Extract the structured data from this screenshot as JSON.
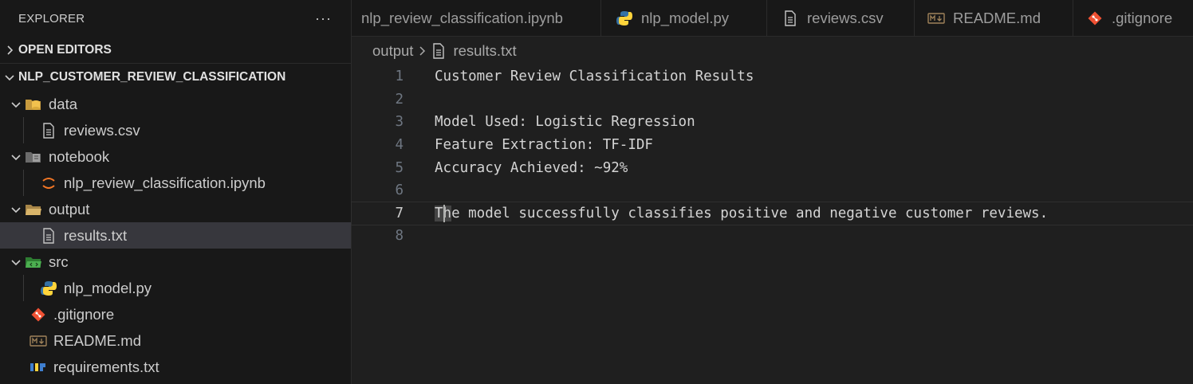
{
  "explorer": {
    "title": "EXPLORER",
    "more_actions": "···",
    "open_editors_label": "OPEN EDITORS",
    "project_label": "NLP_CUSTOMER_REVIEW_CLASSIFICATION",
    "tree": [
      {
        "label": "data",
        "kind": "folder",
        "icon": "folder-data-icon"
      },
      {
        "label": "reviews.csv",
        "kind": "file",
        "icon": "text-file-icon"
      },
      {
        "label": "notebook",
        "kind": "folder",
        "icon": "folder-notebook-icon"
      },
      {
        "label": "nlp_review_classification.ipynb",
        "kind": "file",
        "icon": "jupyter-icon"
      },
      {
        "label": "output",
        "kind": "folder",
        "icon": "folder-output-icon"
      },
      {
        "label": "results.txt",
        "kind": "file",
        "icon": "text-file-icon",
        "selected": true
      },
      {
        "label": "src",
        "kind": "folder",
        "icon": "folder-src-icon"
      },
      {
        "label": "nlp_model.py",
        "kind": "file",
        "icon": "python-icon"
      },
      {
        "label": ".gitignore",
        "kind": "file",
        "icon": "git-icon"
      },
      {
        "label": "README.md",
        "kind": "file",
        "icon": "markdown-icon"
      },
      {
        "label": "requirements.txt",
        "kind": "file",
        "icon": "pip-requirements-icon"
      }
    ]
  },
  "tabs": [
    {
      "label": "nlp_review_classification.ipynb",
      "icon": "none"
    },
    {
      "label": "nlp_model.py",
      "icon": "python-icon"
    },
    {
      "label": "reviews.csv",
      "icon": "text-file-icon"
    },
    {
      "label": "README.md",
      "icon": "markdown-icon"
    },
    {
      "label": ".gitignore",
      "icon": "git-icon"
    }
  ],
  "breadcrumb": {
    "folder": "output",
    "file": "results.txt"
  },
  "editor": {
    "active_line": 7,
    "lines": [
      {
        "num": "1",
        "text": "Customer Review Classification Results"
      },
      {
        "num": "2",
        "text": ""
      },
      {
        "num": "3",
        "text": "Model Used: Logistic Regression"
      },
      {
        "num": "4",
        "text": "Feature Extraction: TF-IDF"
      },
      {
        "num": "5",
        "text": "Accuracy Achieved: ~92%"
      },
      {
        "num": "6",
        "text": ""
      },
      {
        "num": "7",
        "text": "The model successfully classifies positive and negative customer reviews."
      },
      {
        "num": "8",
        "text": ""
      }
    ]
  },
  "colors": {
    "folder_data": "#e8b64c",
    "folder_output": "#c09553",
    "folder_src": "#4caf50",
    "python_blue": "#3572a5",
    "python_yellow": "#ffd43b",
    "git_red": "#f05133",
    "jupyter_orange": "#f37726"
  }
}
